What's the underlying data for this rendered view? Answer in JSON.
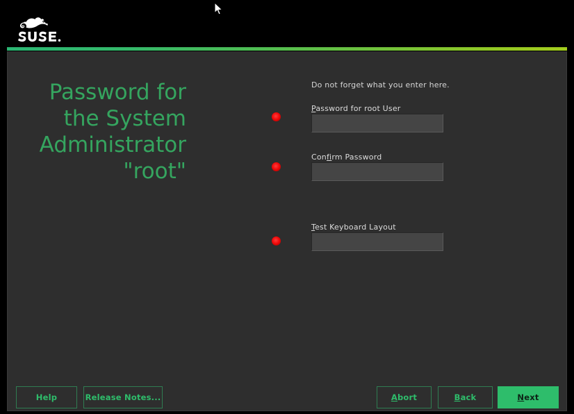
{
  "window": {
    "brand_logo_alt": "SUSE",
    "brand_wordmark": "SUSE."
  },
  "heading": {
    "text": "Password for\nthe System\nAdministrator\n\"root\""
  },
  "form": {
    "hint": "Do not forget what you enter here.",
    "fields": [
      {
        "label_prefix": "",
        "label_accel": "P",
        "label_suffix": "assword for root User",
        "value": "",
        "placeholder": "",
        "status": "empty"
      },
      {
        "label_prefix": "Con",
        "label_accel": "fi",
        "label_suffix": "rm Password",
        "value": "",
        "placeholder": "",
        "status": "empty"
      },
      {
        "label_prefix": "",
        "label_accel": "T",
        "label_suffix": "est Keyboard Layout",
        "value": "",
        "placeholder": "",
        "status": "empty"
      }
    ]
  },
  "buttons": {
    "help": {
      "prefix": "",
      "accel": "",
      "suffix": "Help"
    },
    "release_notes": {
      "prefix": "",
      "accel": "",
      "suffix": "Release Notes..."
    },
    "abort": {
      "prefix": "",
      "accel": "A",
      "suffix": "bort"
    },
    "back": {
      "prefix": "",
      "accel": "B",
      "suffix": "ack"
    },
    "next": {
      "prefix": "",
      "accel": "N",
      "suffix": "ext"
    }
  },
  "colors": {
    "accent_green": "#2ebd6b",
    "heading_green": "#35a55f",
    "gradient_start": "#2bb673",
    "gradient_end": "#a3cc1e",
    "status_red": "#ef0a0a",
    "panel_bg": "#2e2e2e",
    "page_bg": "#000000",
    "input_bg": "#454545"
  }
}
